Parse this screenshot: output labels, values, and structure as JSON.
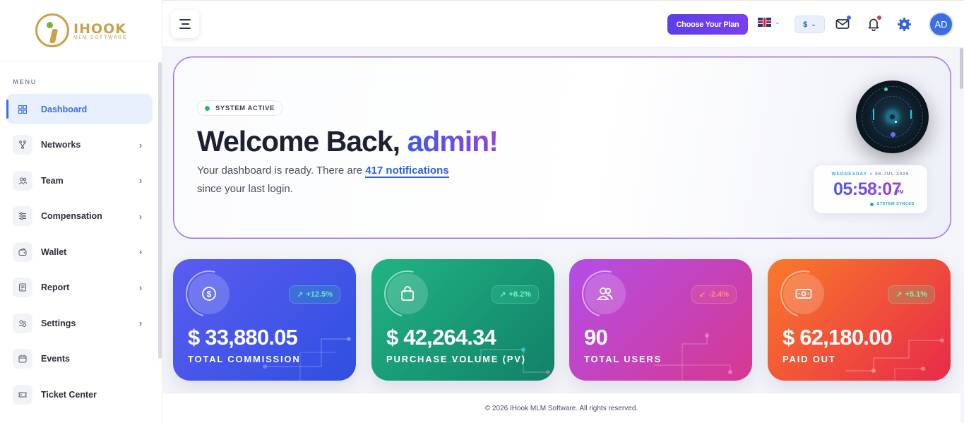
{
  "brand": {
    "name": "IHOOK",
    "tagline": "MLM SOFTWARE"
  },
  "sidebar": {
    "menu_label": "MENU",
    "items": [
      {
        "label": "Dashboard",
        "icon": "dashboard-grid-icon",
        "active": true,
        "has_children": false
      },
      {
        "label": "Networks",
        "icon": "network-icon",
        "active": false,
        "has_children": true
      },
      {
        "label": "Team",
        "icon": "team-icon",
        "active": false,
        "has_children": true
      },
      {
        "label": "Compensation",
        "icon": "sliders-icon",
        "active": false,
        "has_children": true
      },
      {
        "label": "Wallet",
        "icon": "wallet-icon",
        "active": false,
        "has_children": true
      },
      {
        "label": "Report",
        "icon": "report-icon",
        "active": false,
        "has_children": true
      },
      {
        "label": "Settings",
        "icon": "settings-icon",
        "active": false,
        "has_children": true
      },
      {
        "label": "Events",
        "icon": "calendar-icon",
        "active": false,
        "has_children": false
      },
      {
        "label": "Ticket Center",
        "icon": "ticket-icon",
        "active": false,
        "has_children": false
      }
    ]
  },
  "topbar": {
    "plan_button": "Choose Your Plan",
    "language": "EN-GB",
    "currency": "$",
    "avatar_initials": "AD",
    "notification_color": "#e5384b",
    "mail_dot_color": "#3b6fe0"
  },
  "hero": {
    "status": "SYSTEM ACTIVE",
    "welcome_prefix": "Welcome Back, ",
    "username": "admin!",
    "desc_prefix": "Your dashboard is ready. There are ",
    "notifications_link": "417 notifications",
    "desc_suffix": "since your last login.",
    "clock": {
      "day": "WEDNESDAY",
      "date": "08 JUL 2026",
      "time": "05:58:07",
      "ampm": "PM",
      "sync": "SYSTEM SYNCED"
    }
  },
  "stats": [
    {
      "value": "$ 33,880.05",
      "label": "TOTAL COMMISSION",
      "trend": "+12.5%",
      "trend_dir": "up",
      "icon": "dollar-icon",
      "gradient": [
        "#5a5cf0",
        "#2f4fe0"
      ],
      "trend_color": "#6ee7c4"
    },
    {
      "value": "$ 42,264.34",
      "label": "PURCHASE VOLUME (PV)",
      "trend": "+8.2%",
      "trend_dir": "up",
      "icon": "shopping-bag-icon",
      "gradient": [
        "#20b483",
        "#128068"
      ],
      "trend_color": "#7ff0c9"
    },
    {
      "value": "90",
      "label": "TOTAL USERS",
      "trend": "-2.4%",
      "trend_dir": "down",
      "icon": "users-icon",
      "gradient": [
        "#b34ee8",
        "#d6388f"
      ],
      "trend_color": "#ff8c8c"
    },
    {
      "value": "$ 62,180.00",
      "label": "PAID OUT",
      "trend": "+5.1%",
      "trend_dir": "up",
      "icon": "cash-icon",
      "gradient": [
        "#f97a2a",
        "#e72a4a"
      ],
      "trend_color": "#7ff0a9"
    }
  ],
  "footer": {
    "text": "© 2026 IHook MLM Software. All rights reserved."
  }
}
